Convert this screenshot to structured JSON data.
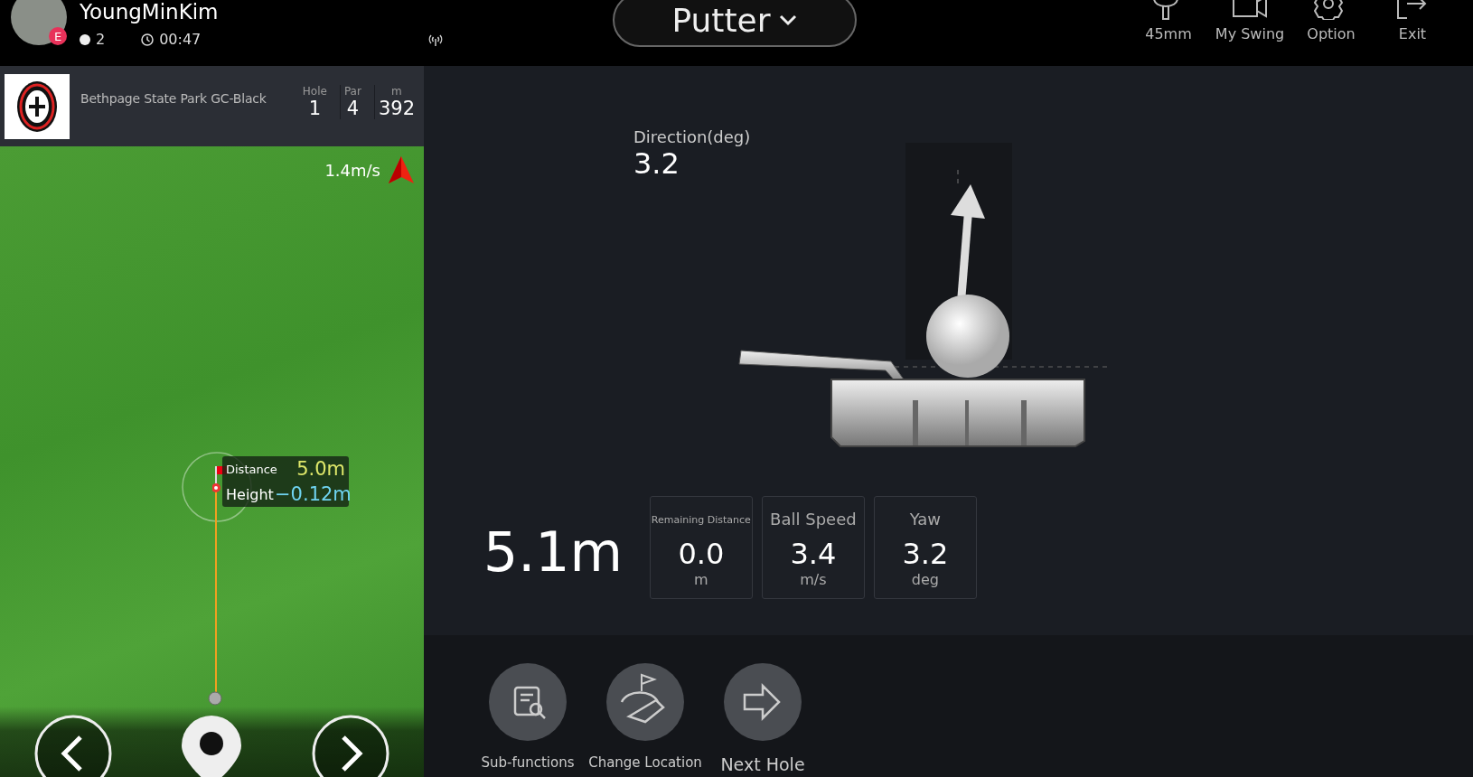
{
  "player": {
    "name": "YoungMinKim",
    "badge": "E",
    "balls": "2",
    "time": "00:47"
  },
  "club_selector": {
    "label": "Putter"
  },
  "toolbar": [
    {
      "kind": "tee",
      "label": "45mm"
    },
    {
      "kind": "camera",
      "label": "My Swing"
    },
    {
      "kind": "gear",
      "label": "Option"
    },
    {
      "kind": "exit",
      "label": "Exit"
    }
  ],
  "course": {
    "name": "Bethpage State Park GC-Black",
    "stats": [
      {
        "label": "Hole",
        "value": "1"
      },
      {
        "label": "Par",
        "value": "4"
      },
      {
        "label": "m",
        "value": "392"
      }
    ]
  },
  "map": {
    "wind": "1.4m/s",
    "popup": [
      {
        "kind": "distance",
        "label": "Distance",
        "value": "5.0m"
      },
      {
        "kind": "height",
        "label": "Height",
        "value": "−0.12m"
      }
    ]
  },
  "shot": {
    "direction_label": "Direction(deg)",
    "direction_value": "3.2",
    "total": "5.1m",
    "metrics": [
      {
        "kind": "small",
        "label": "Remaining Distance",
        "value": "0.0",
        "unit": "m"
      },
      {
        "kind": "normal",
        "label": "Ball Speed",
        "value": "3.4",
        "unit": "m/s"
      },
      {
        "kind": "normal",
        "label": "Yaw",
        "value": "3.2",
        "unit": "deg"
      }
    ]
  },
  "actions": [
    {
      "kind": "sub",
      "label": "Sub-functions"
    },
    {
      "kind": "location",
      "label": "Change Location"
    },
    {
      "kind": "next",
      "label": "Next Hole"
    }
  ]
}
